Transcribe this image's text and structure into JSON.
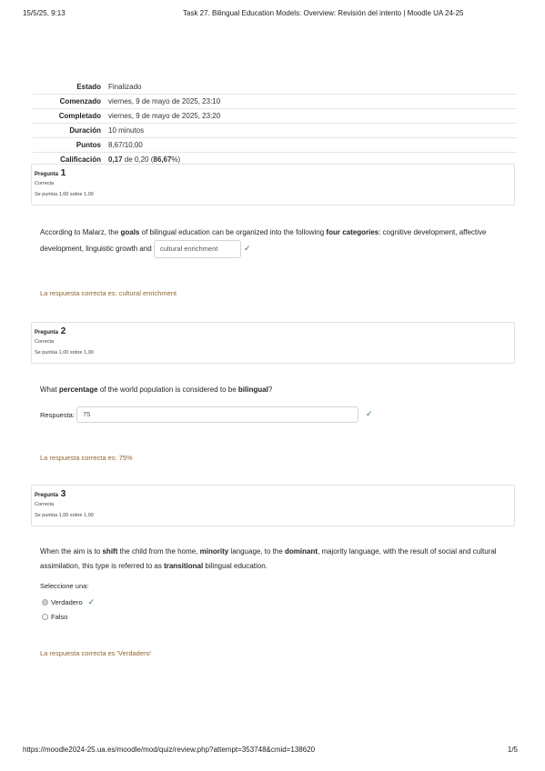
{
  "print_header": {
    "date": "15/5/25, 9:13",
    "title": "Task 27. Bilingual Education Models: Overview: Revisión del intento | Moodle UA 24-25"
  },
  "print_footer": {
    "url": "https://moodle2024-25.ua.es/moodle/mod/quiz/review.php?attempt=353748&cmid=138620",
    "page": "1/5"
  },
  "summary": [
    {
      "label": "Estado",
      "value": "Finalizado"
    },
    {
      "label": "Comenzado",
      "value": "viernes, 9 de mayo de 2025, 23:10"
    },
    {
      "label": "Completado",
      "value": "viernes, 9 de mayo de 2025, 23:20"
    },
    {
      "label": "Duración",
      "value": "10 minutos"
    },
    {
      "label": "Puntos",
      "value": "8,67/10,00"
    },
    {
      "label": "Calificación",
      "value_bold": "0,17",
      "value_mid": " de 0,20 (",
      "value_pct": "86,67",
      "value_end": "%)"
    }
  ],
  "questions": [
    {
      "label": "Pregunta",
      "number": "1",
      "state": "Correcta",
      "grade": "Se puntúa 1,00 sobre 1,00",
      "text_parts": [
        "According to Malarz, the ",
        "goals",
        " of bilingual education can be organized into the following ",
        "four categories",
        ": cognitive development, affective development, linguistic growth and "
      ],
      "answer": "cultural enrichment",
      "right_answer": "La respuesta correcta es: cultural enrichment"
    },
    {
      "label": "Pregunta",
      "number": "2",
      "state": "Correcta",
      "grade": "Se puntúa 1,00 sobre 1,00",
      "text_parts": [
        "What ",
        "percentage",
        " of the world population is considered to be ",
        "bilingual",
        "?"
      ],
      "response_label": "Respuesta:",
      "answer": "75",
      "right_answer": "La respuesta correcta es: 75%"
    },
    {
      "label": "Pregunta",
      "number": "3",
      "state": "Correcta",
      "grade": "Se puntúa 1,00 sobre 1,00",
      "text_parts": [
        "When the aim is to ",
        "shift",
        " the child from the home, ",
        "minority",
        " language, to the ",
        "dominant",
        ", majority language, with the result of social and cultural assimilation, this type is referred to as ",
        "transitional",
        " bilingual education."
      ],
      "prompt": "Seleccione una:",
      "options": [
        {
          "label": "Verdadero",
          "selected": true
        },
        {
          "label": "Falso",
          "selected": false
        }
      ],
      "right_answer": "La respuesta correcta es 'Verdadero'"
    }
  ],
  "icons": {
    "correct": "check-icon",
    "radio": "radio-icon"
  },
  "colors": {
    "correct": "#357a32",
    "right_answer": "#8e662e",
    "border": "#dee2e6"
  }
}
